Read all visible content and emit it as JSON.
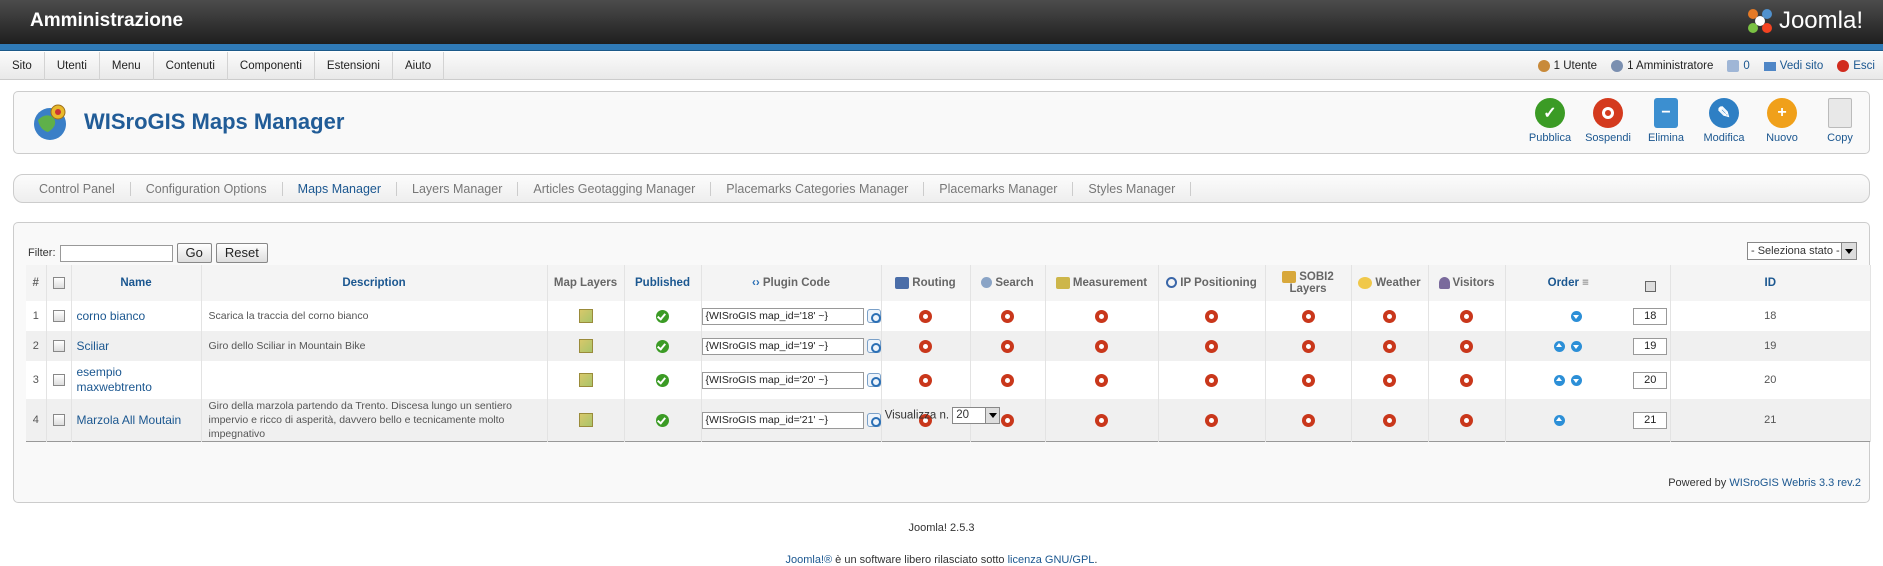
{
  "header": {
    "title": "Amministrazione",
    "logo_text": "Joomla!"
  },
  "menu": [
    "Sito",
    "Utenti",
    "Menu",
    "Contenuti",
    "Componenti",
    "Estensioni",
    "Aiuto"
  ],
  "status": {
    "users": "1 Utente",
    "admins": "1 Amministratore",
    "messages": "0",
    "view_site": "Vedi sito",
    "logout": "Esci"
  },
  "toolbar": {
    "title": "WISroGIS Maps Manager",
    "buttons": [
      {
        "label": "Pubblica",
        "color": "#3b9b25",
        "icon": "check-icon"
      },
      {
        "label": "Sospendi",
        "color": "#d43a1e",
        "icon": "stop-icon"
      },
      {
        "label": "Elimina",
        "color": "#3c8fd0",
        "icon": "trash-icon"
      },
      {
        "label": "Modifica",
        "color": "#2e7fc4",
        "icon": "pencil-icon"
      },
      {
        "label": "Nuovo",
        "color": "#f0a01a",
        "icon": "plus-icon"
      },
      {
        "label": "Copy",
        "color": "#e8e8e8",
        "icon": "copy-icon"
      }
    ]
  },
  "tabs": [
    "Control Panel",
    "Configuration Options",
    "Maps Manager",
    "Layers Manager",
    "Articles Geotagging Manager",
    "Placemarks Categories Manager",
    "Placemarks Manager",
    "Styles Manager"
  ],
  "active_tab": "Maps Manager",
  "filter": {
    "label": "Filter:",
    "value": "",
    "go": "Go",
    "reset": "Reset"
  },
  "state_select": "- Seleziona stato -",
  "columns": [
    "#",
    "Name",
    "Description",
    "Map Layers",
    "Published",
    "Plugin Code",
    "Routing",
    "Search",
    "Measurement",
    "IP Positioning",
    "SOBI2 Layers",
    "Weather",
    "Visitors",
    "Order",
    "ID"
  ],
  "rows": [
    {
      "num": "1",
      "name": "corno bianco",
      "desc": "Scarica la traccia del corno bianco",
      "code": "{WISroGIS map_id='18' ~}",
      "order": "18",
      "id": "18",
      "up": false,
      "down": true
    },
    {
      "num": "2",
      "name": "Sciliar",
      "desc": "Giro dello Sciliar in Mountain Bike",
      "code": "{WISroGIS map_id='19' ~}",
      "order": "19",
      "id": "19",
      "up": true,
      "down": true
    },
    {
      "num": "3",
      "name": "esempio maxwebtrento",
      "desc": "",
      "code": "{WISroGIS map_id='20' ~}",
      "order": "20",
      "id": "20",
      "up": true,
      "down": true
    },
    {
      "num": "4",
      "name": "Marzola All Moutain",
      "desc": "Giro della marzola partendo da Trento. Discesa lungo un sentiero impervio e ricco di asperità, davvero bello e tecnicamente molto impegnativo",
      "code": "{WISroGIS map_id='21' ~}",
      "order": "21",
      "id": "21",
      "up": true,
      "down": false
    }
  ],
  "pager": {
    "label": "Visualizza n.",
    "value": "20"
  },
  "powered": {
    "prefix": "Powered by",
    "link": "WISroGIS Webris 3.3 rev.2"
  },
  "footer": {
    "version": "Joomla! 2.5.3",
    "license_prefix": "Joomla!®",
    "license_text": " è un software libero rilasciato sotto ",
    "license_link": "licenza GNU/GPL",
    "license_suffix": "."
  }
}
